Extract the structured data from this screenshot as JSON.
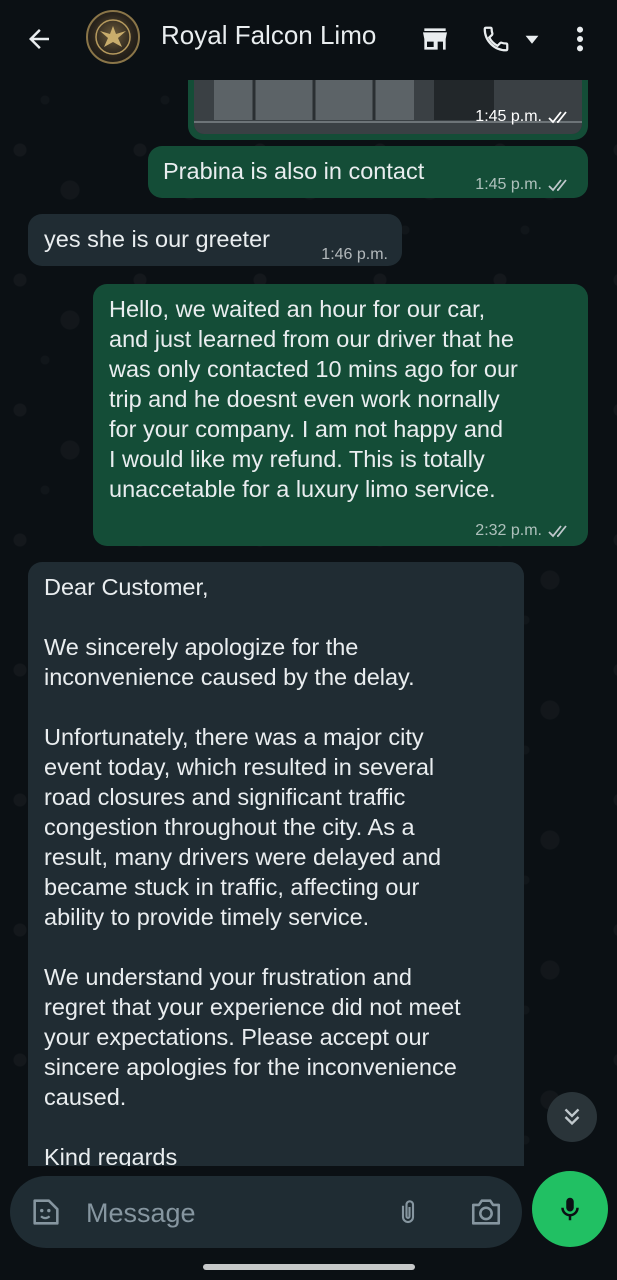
{
  "header": {
    "contact_name": "Royal Falcon Limo",
    "icons": [
      "back-arrow-icon",
      "avatar",
      "storefront-icon",
      "phone-icon",
      "dropdown-caret-icon",
      "more-vert-icon"
    ]
  },
  "messages": [
    {
      "direction": "out",
      "type": "image",
      "time": "1:45 p.m.",
      "status": "read"
    },
    {
      "direction": "out",
      "text": "Prabina is also in contact",
      "time": "1:45 p.m.",
      "status": "read"
    },
    {
      "direction": "in",
      "text": "yes she is our greeter",
      "time": "1:46 p.m."
    },
    {
      "direction": "out",
      "text": "Hello, we waited an hour for our car,\nand just learned from our driver that he\nwas only contacted 10 mins ago for our\ntrip and he doesnt even work nornally\nfor your company. I am not happy and\nI would like my refund. This is totally\nunaccetable for a luxury limo service.",
      "time": "2:32 p.m.",
      "status": "read"
    },
    {
      "direction": "in",
      "text": "Dear Customer,\n\nWe sincerely apologize for the\ninconvenience caused by the delay.\n\nUnfortunately, there was a major city\nevent today, which resulted in several\nroad closures and significant traffic\ncongestion throughout the city. As a\nresult, many drivers were delayed and\nbecame stuck in traffic, affecting our\nability to provide timely service.\n\nWe understand your frustration and\nregret that your experience did not meet\nyour expectations. Please accept our\nsincere apologies for the inconvenience\ncaused.\n\nKind regards"
    }
  ],
  "composer": {
    "placeholder": "Message"
  },
  "colors": {
    "background": "#0b1014",
    "outgoing_bubble": "#144d37",
    "incoming_bubble": "#202c33",
    "mic_button": "#21c063"
  }
}
